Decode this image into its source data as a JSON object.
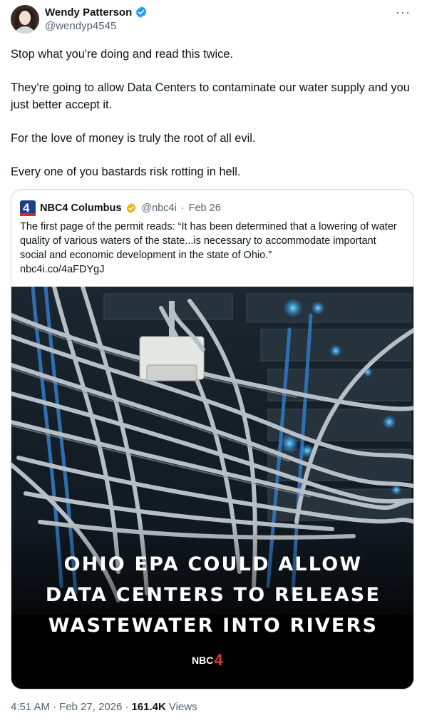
{
  "author": {
    "name": "Wendy Patterson",
    "handle": "@wendyp4545"
  },
  "more_label": "···",
  "tweet_text": [
    "Stop what you're doing and read this twice.",
    "They're going to allow Data Centers to contaminate our water supply and you just better accept it.",
    "For the love of money is truly the root of all evil.",
    "Every one of you bastards risk rotting in hell."
  ],
  "quote": {
    "logo_text": "4",
    "name": "NBC4 Columbus",
    "handle": "@nbc4i",
    "separator": "·",
    "date": "Feb 26",
    "text": "The first page of the permit reads: “It has been determined that a lowering of water quality of various waters of the state...is necessary to accommodate important social and economic development in the state of Ohio.”",
    "link": "nbc4i.co/4aFDYgJ",
    "image_caption": [
      "OHIO EPA COULD ALLOW",
      "DATA CENTERS TO RELEASE",
      "WASTEWATER INTO RIVERS"
    ],
    "image_logo": {
      "text": "NBC",
      "num": "4"
    }
  },
  "footer": {
    "time": "4:51 AM",
    "sep1": "·",
    "date": "Feb 27, 2026",
    "sep2": "·",
    "views_count": "161.4K",
    "views_label": "Views"
  },
  "colors": {
    "verified_blue": "#1d9bf0",
    "gold_badge": "#e2b719",
    "secondary_text": "#536471",
    "border": "#cfd9de"
  }
}
